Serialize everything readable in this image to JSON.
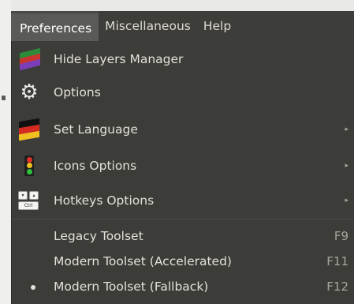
{
  "menubar": {
    "items": [
      {
        "label": "Preferences",
        "active": true
      },
      {
        "label": "Miscellaneous",
        "active": false
      },
      {
        "label": "Help",
        "active": false
      }
    ]
  },
  "menu": {
    "items": [
      {
        "label": "Hide Layers Manager",
        "icon": "layers-icon",
        "submenu": false
      },
      {
        "label": "Options",
        "icon": "gear-icon",
        "submenu": false
      },
      {
        "label": "Set Language",
        "icon": "flag-icon",
        "submenu": true
      },
      {
        "label": "Icons Options",
        "icon": "traffic-light-icon",
        "submenu": true
      },
      {
        "label": "Hotkeys Options",
        "icon": "keyboard-keys-icon",
        "submenu": true
      }
    ],
    "toolsets": [
      {
        "label": "Legacy Toolset",
        "shortcut": "F9",
        "selected": false
      },
      {
        "label": "Modern Toolset (Accelerated)",
        "shortcut": "F11",
        "selected": false
      },
      {
        "label": "Modern Toolset (Fallback)",
        "shortcut": "F12",
        "selected": true
      }
    ],
    "submenu_arrow": "▸",
    "keys_icon_text": "Ctrl"
  },
  "colors": {
    "menubar_bg": "#3d3d3a",
    "menu_bg": "#3c3c39",
    "active_item_bg": "#5a5a56",
    "text": "#e4e1da",
    "shortcut_text": "#a8a59e"
  }
}
